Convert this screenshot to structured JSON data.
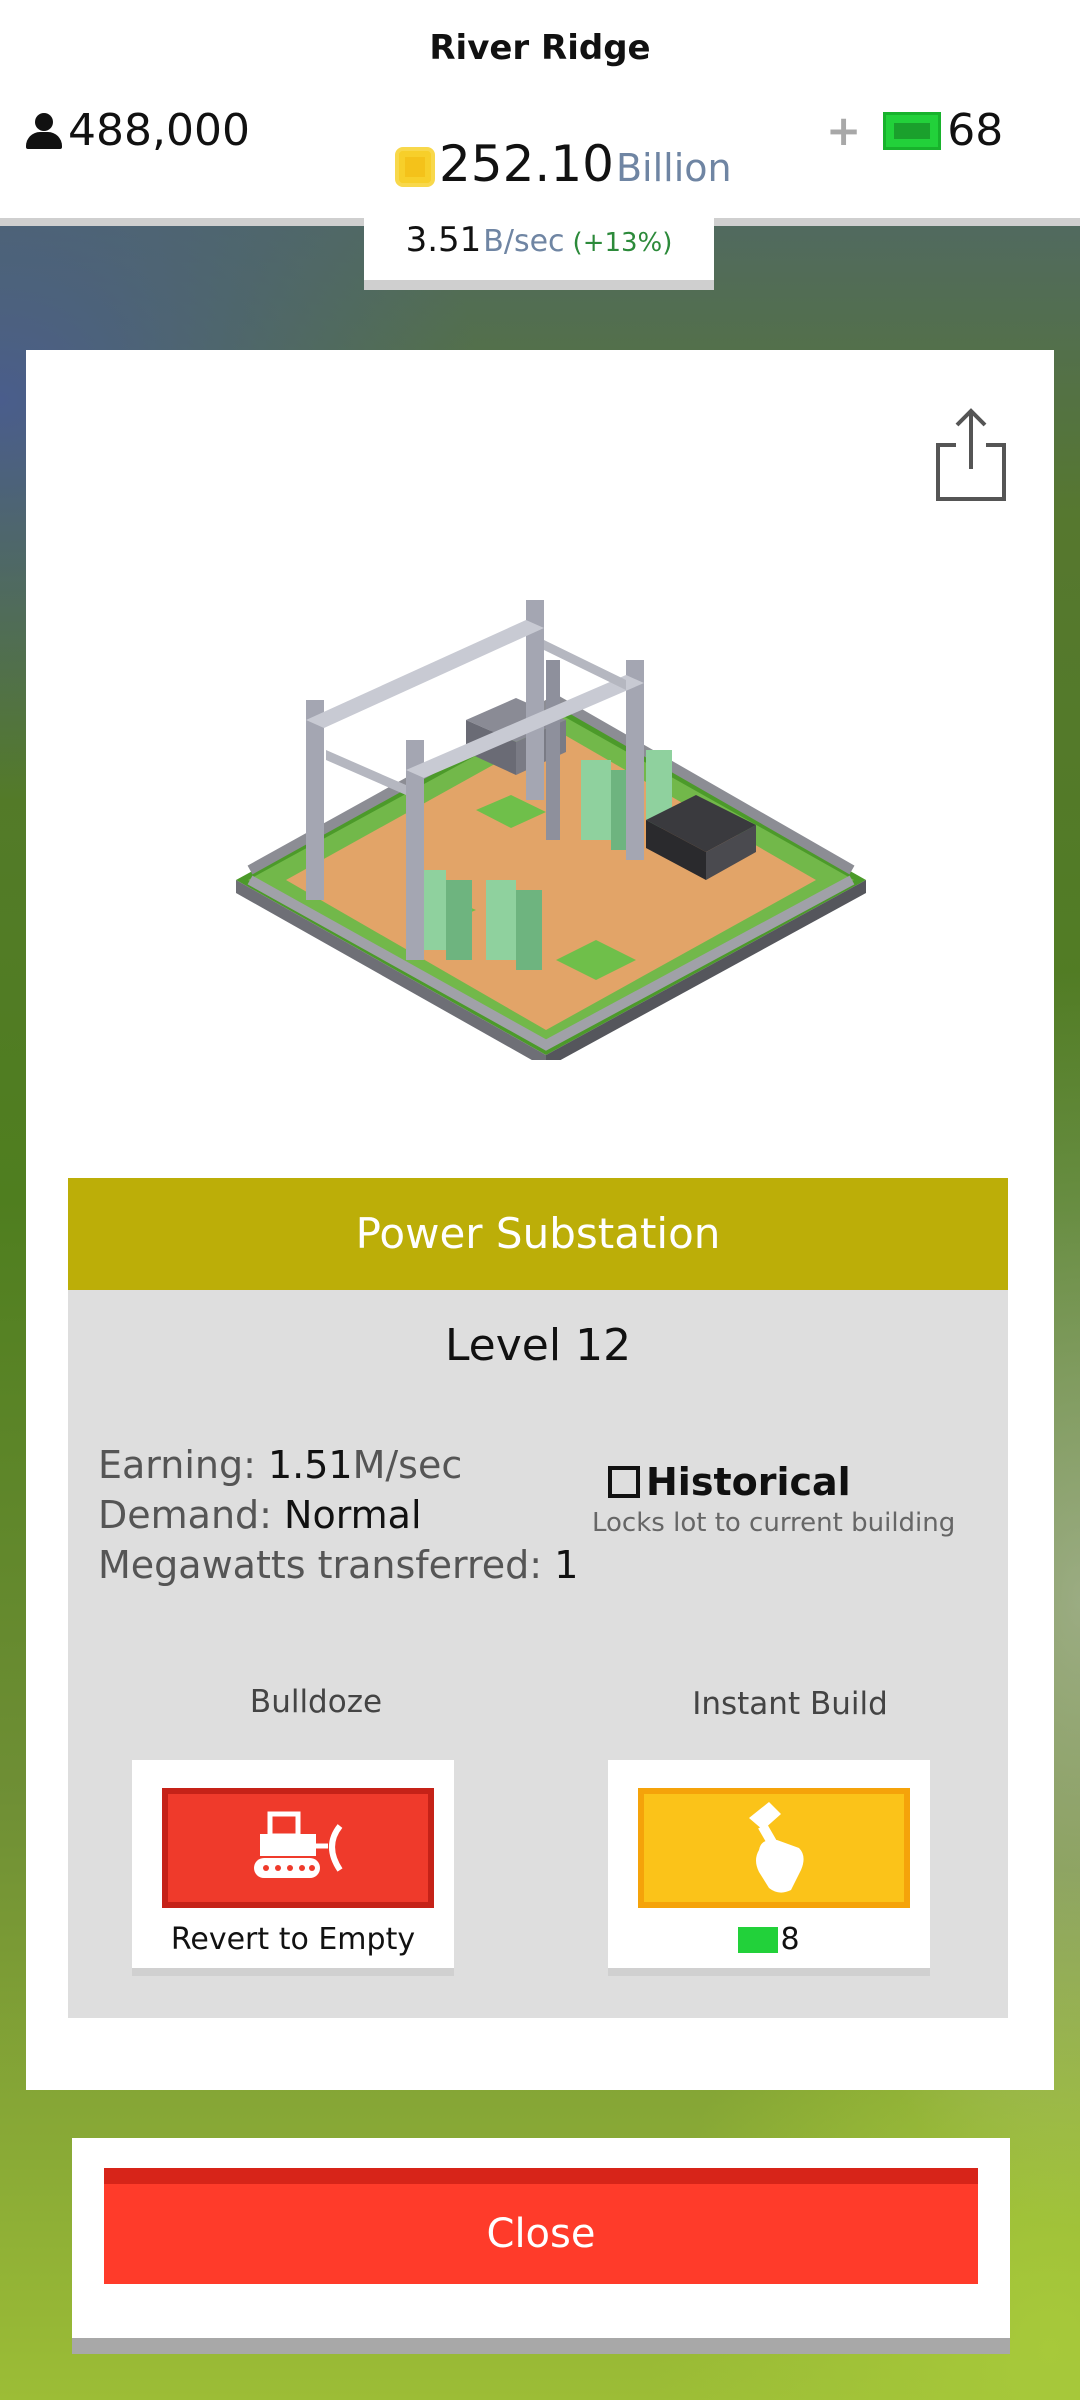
{
  "header": {
    "city_name": "River Ridge",
    "population": "488,000",
    "coins_amount": "252.10",
    "coins_unit": "Billion",
    "cash_plus": "+",
    "cash_amount": "68",
    "rate_amount": "3.51",
    "rate_unit": "B/sec",
    "rate_change": "(+13%)"
  },
  "building": {
    "name": "Power Substation",
    "level": "Level 12",
    "stats": {
      "earning_label": "Earning: ",
      "earning_value": "1.51",
      "earning_unit": "M/sec",
      "demand_label": "Demand: ",
      "demand_value": "Normal",
      "megawatts_label": "Megawatts transferred: ",
      "megawatts_value": "1"
    },
    "historical_label": "Historical",
    "historical_checked": false,
    "historical_desc": "Locks lot to current building"
  },
  "actions": {
    "bulldoze_label": "Bulldoze",
    "bulldoze_caption": "Revert to Empty",
    "instant_build_label": "Instant Build",
    "instant_build_cost": "8"
  },
  "close_label": "Close",
  "icons": {
    "population": "person-icon",
    "coins": "coin-icon",
    "cash": "cash-icon",
    "share": "share-icon",
    "bulldoze": "bulldozer-icon",
    "instant_build": "hammer-hand-icon"
  },
  "colors": {
    "title_bar": "#bcae08",
    "bulldoze": "#ef3a2b",
    "instant_build": "#fbc319",
    "close": "#ff3b2a",
    "cash": "#22d13a",
    "coin": "#f4c21a"
  }
}
